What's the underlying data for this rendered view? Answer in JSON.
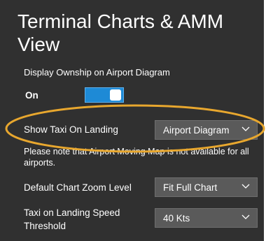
{
  "title": "Terminal Charts & AMM View",
  "ownship": {
    "label": "Display Ownship on Airport Diagram",
    "state": "On",
    "enabled": true
  },
  "taxi_on_landing": {
    "label": "Show Taxi On Landing",
    "value": "Airport Diagram",
    "note": "Please note that Airport Moving Map is not available for all airports."
  },
  "chart_zoom": {
    "label": "Default Chart Zoom Level",
    "value": "Fit Full Chart"
  },
  "taxi_speed": {
    "label": "Taxi on Landing Speed Threshold",
    "value": "40 Kts"
  },
  "colors": {
    "panel_bg": "#303030",
    "dropdown_bg": "#5a5a5a",
    "toggle_on": "#1e8ad6",
    "highlight": "#e8a72e"
  },
  "icons": {
    "dropdown": "chevron-down-icon"
  }
}
